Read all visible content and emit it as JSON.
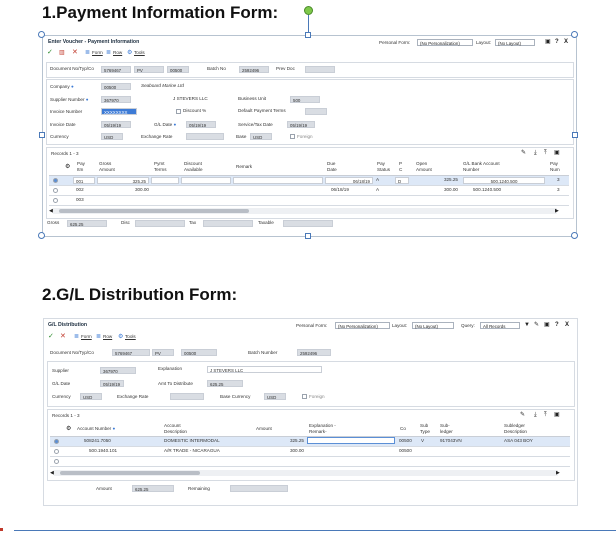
{
  "headings": {
    "h1": "1.Payment Information Form:",
    "h2": "2.G/L Distribution Form:"
  },
  "voucher": {
    "title": "Enter Voucher - Payment Information",
    "personal_form_label": "Personal Form:",
    "personal_form_value": "(No Personalization)",
    "layout_label": "Layout:",
    "layout_value": "(No Layout)",
    "toolbar": {
      "form": "Form",
      "row": "Row",
      "tools": "Tools"
    },
    "doc_label": "Document No/Typ/Co",
    "doc_no": "5769467",
    "doc_type": "PV",
    "doc_co": "00500",
    "batch_label": "Batch No",
    "batch_no": "2592496",
    "prev_doc_label": "Prev Doc",
    "company_label": "Company",
    "company_value": "00500",
    "company_name": "Seaboard Marine Ltd",
    "supplier_label": "Supplier Number",
    "supplier_value": "367970",
    "supplier_name": "J STEVERS LLC",
    "business_unit_label": "Business Unit",
    "business_unit_value": "500",
    "invoice_label": "Invoice Number",
    "invoice_value": "XXXXXXXX",
    "discount_pct_label": "Discount %",
    "default_terms_label": "Default Payment Terms",
    "invoice_date_label": "Invoice Date",
    "invoice_date_value": "05/19/19",
    "gl_date_label": "G/L Date",
    "gl_date_value": "05/19/19",
    "service_date_label": "Service/Tax Date",
    "service_date_value": "05/19/19",
    "currency_label": "Currency",
    "currency_value": "USD",
    "exchange_rate_label": "Exchange Rate",
    "base_label": "Base",
    "base_value": "USD",
    "foreign_label": "Foreign",
    "records_label": "Records 1 - 3",
    "columns": [
      "Pay Itm",
      "Gross Amount",
      "Pymt Terms",
      "Discount Available",
      "Remark",
      "Due Date",
      "Pay Status",
      "P C",
      "Open Amount",
      "G/L Bank Account Number",
      "Pay Num"
    ],
    "rows": [
      {
        "pay_itm": "001",
        "gross": "325.25",
        "due": "06/18/19",
        "status": "A",
        "pc": "D",
        "open": "325.25",
        "bank": "500.1240.500",
        "paynum": "3"
      },
      {
        "pay_itm": "002",
        "gross": "300.00",
        "due": "06/18/19",
        "status": "A",
        "pc": "",
        "open": "300.00",
        "bank": "500.1240.500",
        "paynum": "3"
      },
      {
        "pay_itm": "003",
        "gross": "",
        "due": "",
        "status": "",
        "pc": "",
        "open": "",
        "bank": "",
        "paynum": ""
      }
    ],
    "footer": {
      "gross_label": "Gross",
      "gross_value": "625.25",
      "disc_label": "Disc",
      "tax_label": "Tax",
      "taxable_label": "Taxable"
    }
  },
  "gl": {
    "title": "G/L Distribution",
    "personal_form_label": "Personal Form:",
    "personal_form_value": "(No Personalization)",
    "layout_label": "Layout:",
    "layout_value": "(No Layout)",
    "query_label": "Query:",
    "query_value": "All Records",
    "toolbar": {
      "form": "Form",
      "row": "Row",
      "tools": "Tools"
    },
    "doc_label": "Document No/Typ/Co",
    "doc_no": "5769467",
    "doc_type": "PV",
    "doc_co": "00500",
    "batch_label": "Batch Number",
    "batch_no": "2592496",
    "supplier_label": "Supplier",
    "supplier_value": "367970",
    "explanation_label": "Explanation",
    "explanation_value": "J STEVERS LLC",
    "gl_date_label": "G/L Date",
    "gl_date_value": "05/19/19",
    "amt_dist_label": "Amt To Distribute",
    "amt_dist_value": "625.25",
    "currency_label": "Currency",
    "currency_value": "USD",
    "exchange_rate_label": "Exchange Rate",
    "base_currency_label": "Base Currency",
    "base_currency_value": "USD",
    "foreign_label": "Foreign",
    "records_label": "Records 1 - 3",
    "columns": [
      "Account Number",
      "Account Description",
      "Amount",
      "Explanation -Remark-",
      "Co",
      "Sub Type",
      "Sub-ledger",
      "Subledger Description"
    ],
    "rows": [
      {
        "account": "508241.7050",
        "desc": "DOMESTIC INTERMODAL",
        "amount": "325.25",
        "co": "00500",
        "subtype": "V",
        "subledger": "917043VN",
        "subdesc": "ASA 043 BOY"
      },
      {
        "account": "500.1940.101",
        "desc": "A/R TRADE - NICARAGUA",
        "amount": "300.00",
        "co": "00500",
        "subtype": "",
        "subledger": "",
        "subdesc": ""
      },
      {
        "account": "",
        "desc": "",
        "amount": "",
        "co": "",
        "subtype": "",
        "subledger": "",
        "subdesc": ""
      }
    ],
    "footer": {
      "amount_label": "Amount",
      "amount_value": "625.25",
      "remaining_label": "Remaining"
    }
  },
  "colors": {
    "accent": "#3d7bd6",
    "handle": "#4a79b8",
    "rotate_handle": "#7ec84a",
    "field_bg": "#d9dde3"
  }
}
